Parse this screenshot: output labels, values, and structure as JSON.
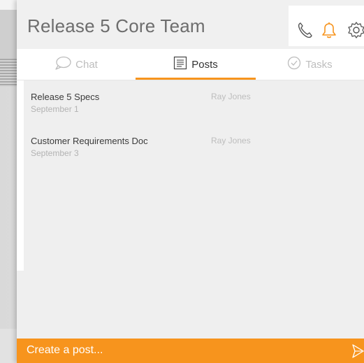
{
  "header": {
    "title": "Release 5 Core Team",
    "icons": [
      "phone-icon",
      "bell-icon",
      "gear-icon"
    ]
  },
  "tabs": [
    {
      "label": "Chat",
      "icon": "chat-bubble-icon",
      "active": false
    },
    {
      "label": "Posts",
      "icon": "document-icon",
      "active": true
    },
    {
      "label": "Tasks",
      "icon": "check-circle-icon",
      "active": false
    }
  ],
  "posts": [
    {
      "title": "Release 5 Specs",
      "date": "September 1",
      "author": "Ray Jones"
    },
    {
      "title": "Customer Requirements Doc",
      "date": "September 3",
      "author": "Ray Jones"
    }
  ],
  "composer": {
    "placeholder": "Create a post...",
    "send_icon": "send-icon"
  },
  "colors": {
    "accent": "#f7941d",
    "title_text": "#6d6d6d",
    "muted_text": "#bdbdbd"
  }
}
